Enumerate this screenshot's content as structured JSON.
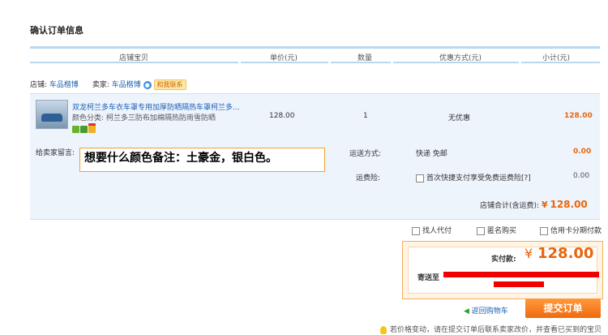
{
  "page": {
    "title": "确认订单信息"
  },
  "columns": [
    "店铺宝贝",
    "单价(元)",
    "数量",
    "优惠方式(元)",
    "小计(元)"
  ],
  "shop": {
    "shop_label": "店铺:",
    "shop_name": "车品楷博",
    "seller_label": "卖家:",
    "seller_name": "车品楷博",
    "contact_label": "和我联系"
  },
  "item": {
    "title": "双龙柯兰多车衣车罩专用加厚防晒隔热车罩柯兰多...",
    "variant": "颜色分类: 柯兰多三防布加棉隔热防雨雪防晒",
    "unit_price": "128.00",
    "quantity": "1",
    "discount": "无优惠",
    "subtotal": "128.00"
  },
  "message": {
    "label": "给卖家留言:",
    "text": "想要什么颜色备注：土豪金，银白色。"
  },
  "shipping": {
    "method_label": "运送方式:",
    "method_value": "快递 免邮",
    "method_price": "0.00",
    "insurance_label": "运费险:",
    "insurance_text": "首次快捷支付享受免费运费险[?]",
    "insurance_price": "0.00"
  },
  "shop_total": {
    "label": "店铺合计(含运费):",
    "currency": "¥",
    "value": "128.00"
  },
  "options": {
    "proxy_pay": "找人代付",
    "anonymous": "匿名购买",
    "installment": "信用卡分期付款"
  },
  "payment": {
    "label": "实付款:",
    "currency": "¥",
    "value": "128.00",
    "ship_to": "寄送至"
  },
  "actions": {
    "back": "返回购物车",
    "submit": "提交订单"
  },
  "notice": "若价格变动，请在提交订单后联系卖家改价，并查看已买到的宝贝"
}
